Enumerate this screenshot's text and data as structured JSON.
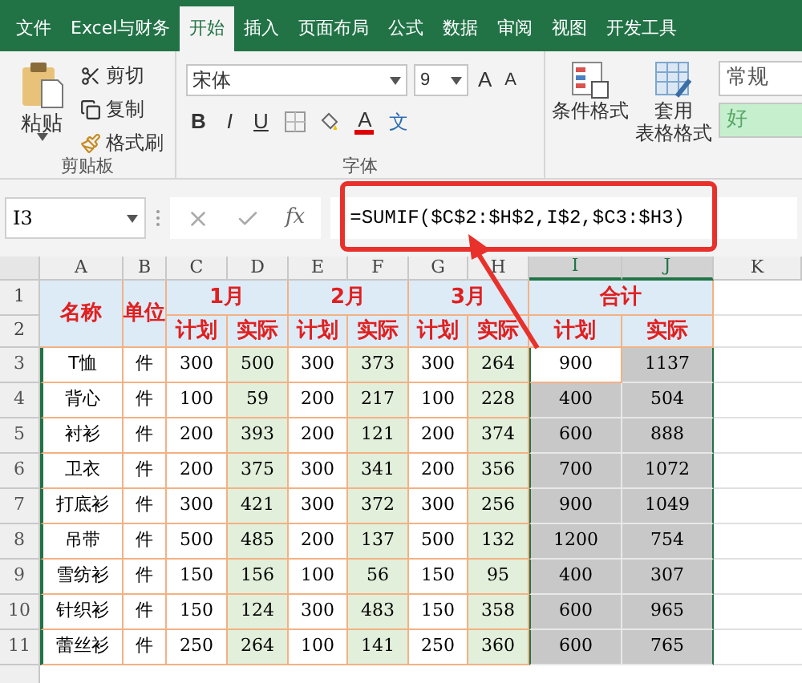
{
  "tabs": [
    {
      "label": "文件",
      "selected": false
    },
    {
      "label": "Excel与财务",
      "selected": false
    },
    {
      "label": "开始",
      "selected": true
    },
    {
      "label": "插入",
      "selected": false
    },
    {
      "label": "页面布局",
      "selected": false
    },
    {
      "label": "公式",
      "selected": false
    },
    {
      "label": "数据",
      "selected": false
    },
    {
      "label": "审阅",
      "selected": false
    },
    {
      "label": "视图",
      "selected": false
    },
    {
      "label": "开发工具",
      "selected": false
    }
  ],
  "ribbon": {
    "clipboard": {
      "paste": "粘贴",
      "cut": "剪切",
      "copy": "复制",
      "format_painter": "格式刷",
      "label": "剪贴板"
    },
    "font": {
      "name": "宋体",
      "size": "9",
      "grow": "A",
      "shrink": "A",
      "bold": "B",
      "italic": "I",
      "underline": "U",
      "color_letter": "A",
      "phonetic": "文",
      "label": "字体"
    },
    "styles": {
      "conditional": "条件格式",
      "table_format_1": "套用",
      "table_format_2": "表格格式",
      "number_format": "常规",
      "good": "好"
    }
  },
  "formula_bar": {
    "name_box": "I3",
    "fx": "fx",
    "formula": "=SUMIF($C$2:$H$2,I$2,$C3:$H3)"
  },
  "columns": [
    {
      "label": "A",
      "selected": false
    },
    {
      "label": "B",
      "selected": false
    },
    {
      "label": "C",
      "selected": false
    },
    {
      "label": "D",
      "selected": false
    },
    {
      "label": "E",
      "selected": false
    },
    {
      "label": "F",
      "selected": false
    },
    {
      "label": "G",
      "selected": false
    },
    {
      "label": "H",
      "selected": false
    },
    {
      "label": "I",
      "selected": true
    },
    {
      "label": "J",
      "selected": true
    },
    {
      "label": "K",
      "selected": false
    }
  ],
  "header": {
    "row_numbers": [
      "1",
      "2"
    ],
    "name": "名称",
    "unit": "单位",
    "groups": [
      "1月",
      "2月",
      "3月",
      "合计"
    ],
    "sub": [
      "计划",
      "实际",
      "计划",
      "实际",
      "计划",
      "实际",
      "计划",
      "实际"
    ]
  },
  "rows": [
    {
      "num": "3",
      "active": true,
      "cells": [
        "T恤",
        "件",
        "300",
        "500",
        "300",
        "373",
        "300",
        "264",
        "900",
        "1137"
      ]
    },
    {
      "num": "4",
      "active": false,
      "cells": [
        "背心",
        "件",
        "100",
        "59",
        "200",
        "217",
        "100",
        "228",
        "400",
        "504"
      ]
    },
    {
      "num": "5",
      "active": false,
      "cells": [
        "衬衫",
        "件",
        "200",
        "393",
        "200",
        "121",
        "200",
        "374",
        "600",
        "888"
      ]
    },
    {
      "num": "6",
      "active": false,
      "cells": [
        "卫衣",
        "件",
        "200",
        "375",
        "300",
        "341",
        "200",
        "356",
        "700",
        "1072"
      ]
    },
    {
      "num": "7",
      "active": false,
      "cells": [
        "打底衫",
        "件",
        "300",
        "421",
        "300",
        "372",
        "300",
        "256",
        "900",
        "1049"
      ]
    },
    {
      "num": "8",
      "active": false,
      "cells": [
        "吊带",
        "件",
        "500",
        "485",
        "200",
        "137",
        "500",
        "132",
        "1200",
        "754"
      ]
    },
    {
      "num": "9",
      "active": false,
      "cells": [
        "雪纺衫",
        "件",
        "150",
        "156",
        "100",
        "56",
        "150",
        "95",
        "400",
        "307"
      ]
    },
    {
      "num": "10",
      "active": false,
      "cells": [
        "针织衫",
        "件",
        "150",
        "124",
        "300",
        "483",
        "150",
        "358",
        "600",
        "965"
      ]
    },
    {
      "num": "11",
      "active": false,
      "cells": [
        "蕾丝衫",
        "件",
        "250",
        "264",
        "100",
        "141",
        "250",
        "360",
        "600",
        "765"
      ]
    }
  ]
}
